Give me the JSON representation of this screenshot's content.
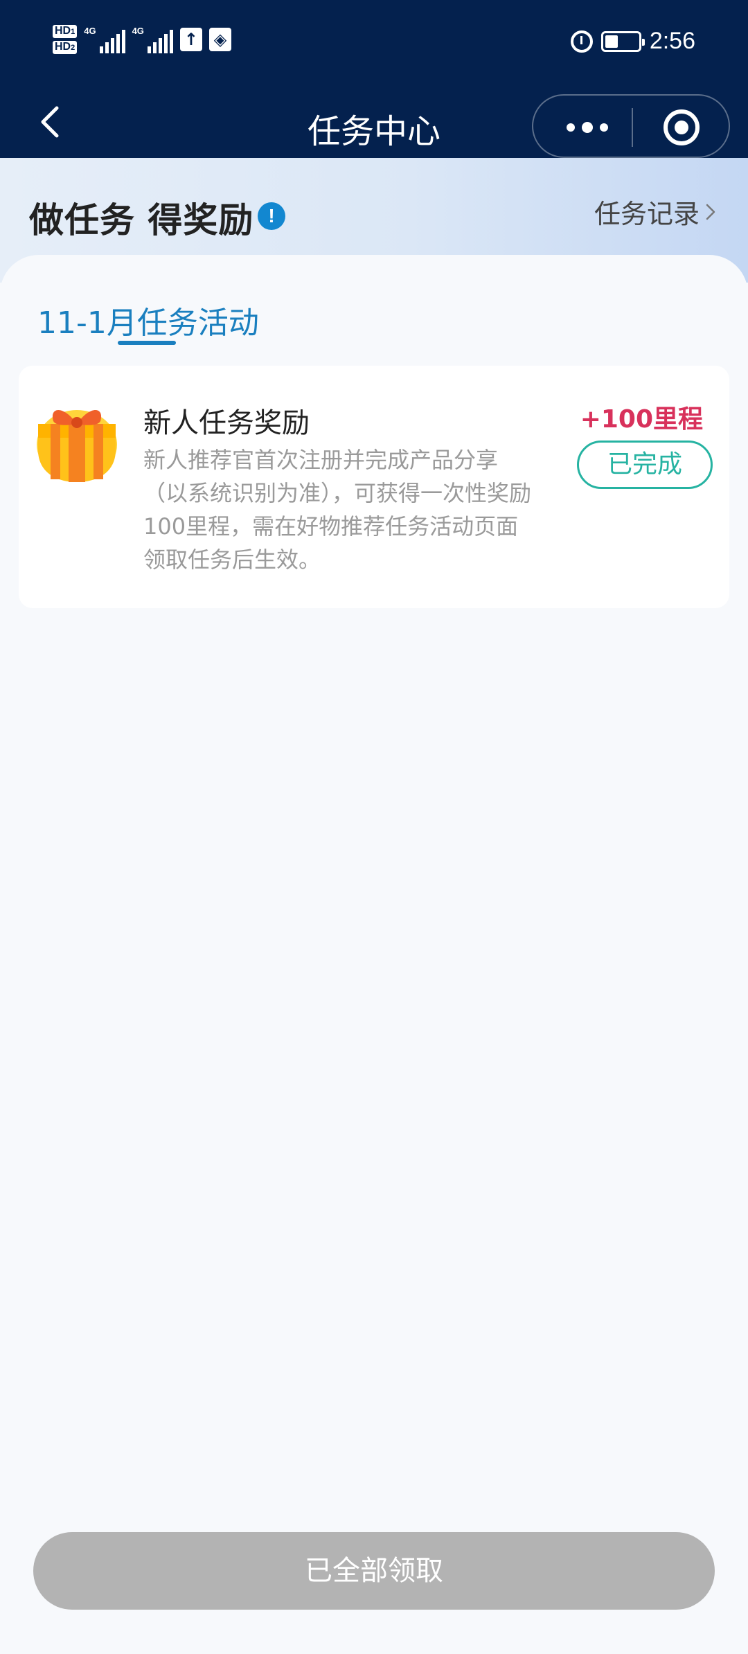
{
  "status_bar": {
    "time": "2:56",
    "hd1": "HD",
    "hd1_sub": "1",
    "hd2": "HD",
    "hd2_sub": "2",
    "net1": "4G",
    "net2": "4G",
    "icons": [
      "hd-icon",
      "signal-icon",
      "upload-icon",
      "app-notification-icon",
      "alarm-icon",
      "battery-icon"
    ]
  },
  "nav": {
    "title": "任务中心",
    "back_icon": "chevron-left-icon",
    "more_icon": "more-dots-icon",
    "close_icon": "target-circle-icon"
  },
  "header": {
    "title": "做任务 得奖励",
    "info_icon_text": "!",
    "record_label": "任务记录"
  },
  "tabs": [
    {
      "label": "11-1月任务活动",
      "active": true
    }
  ],
  "tasks": [
    {
      "title": "新人任务奖励",
      "description": "新人推荐官首次注册并完成产品分享（以系统识别为准），可获得一次性奖励100里程，需在好物推荐任务活动页面领取任务后生效。",
      "reward": "+100里程",
      "status_label": "已完成",
      "icon": "gift-icon"
    }
  ],
  "footer": {
    "claim_all_label": "已全部领取"
  },
  "colors": {
    "nav_bg": "#04214e",
    "accent_blue": "#1a7fbf",
    "reward_red": "#d8315b",
    "done_teal": "#26b3a2",
    "disabled_gray": "#b3b3b3"
  }
}
